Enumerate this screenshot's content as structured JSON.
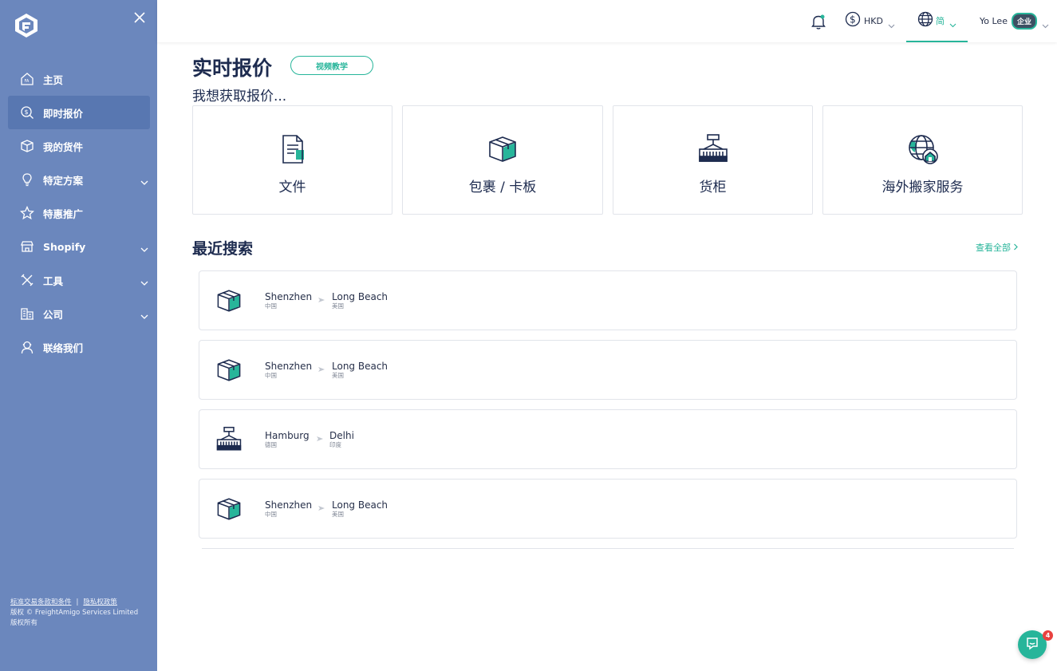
{
  "sidebar": {
    "items": [
      {
        "label": "主页",
        "icon": "home-icon"
      },
      {
        "label": "即时报价",
        "icon": "quote-search-icon",
        "active": true
      },
      {
        "label": "我的货件",
        "icon": "box-icon"
      },
      {
        "label": "特定方案",
        "icon": "bulb-icon",
        "expandable": true
      },
      {
        "label": "特惠推广",
        "icon": "star-icon"
      },
      {
        "label": "Shopify",
        "icon": "store-icon",
        "expandable": true
      },
      {
        "label": "工具",
        "icon": "tools-icon",
        "expandable": true
      },
      {
        "label": "公司",
        "icon": "building-icon",
        "expandable": true
      },
      {
        "label": "联络我们",
        "icon": "support-icon"
      }
    ],
    "footer": {
      "terms_link": "标准交易条款和条件",
      "separator": "|",
      "privacy_link": "隐私权政策",
      "copyright_line1": "版权 © FreightAmigo Services Limited",
      "copyright_line2": "版权所有"
    }
  },
  "topbar": {
    "currency": "HKD",
    "language": "简",
    "user_name": "Yo Lee",
    "user_badge": "企业"
  },
  "main": {
    "title": "实时报价",
    "video_button": "视频教学",
    "subtitle": "我想获取报价...",
    "cards": [
      {
        "label": "文件",
        "icon": "document-icon"
      },
      {
        "label": "包裹 / 卡板",
        "icon": "parcel-icon"
      },
      {
        "label": "货柜",
        "icon": "container-icon"
      },
      {
        "label": "海外搬家服务",
        "icon": "globe-home-icon"
      }
    ],
    "recent_title": "最近搜索",
    "view_all": "查看全部",
    "recent": [
      {
        "type": "parcel",
        "from_city": "Shenzhen",
        "from_country": "中国",
        "to_city": "Long Beach",
        "to_country": "美国"
      },
      {
        "type": "parcel",
        "from_city": "Shenzhen",
        "from_country": "中国",
        "to_city": "Long Beach",
        "to_country": "美国"
      },
      {
        "type": "container",
        "from_city": "Hamburg",
        "from_country": "德国",
        "to_city": "Delhi",
        "to_country": "印度"
      },
      {
        "type": "parcel",
        "from_city": "Shenzhen",
        "from_country": "中国",
        "to_city": "Long Beach",
        "to_country": "美国"
      }
    ]
  },
  "chat": {
    "badge_count": "4"
  },
  "colors": {
    "sidebar": "#6b87bd",
    "sidebar_active": "#5877b1",
    "accent": "#27b59a",
    "navy": "#1d2b4f"
  }
}
